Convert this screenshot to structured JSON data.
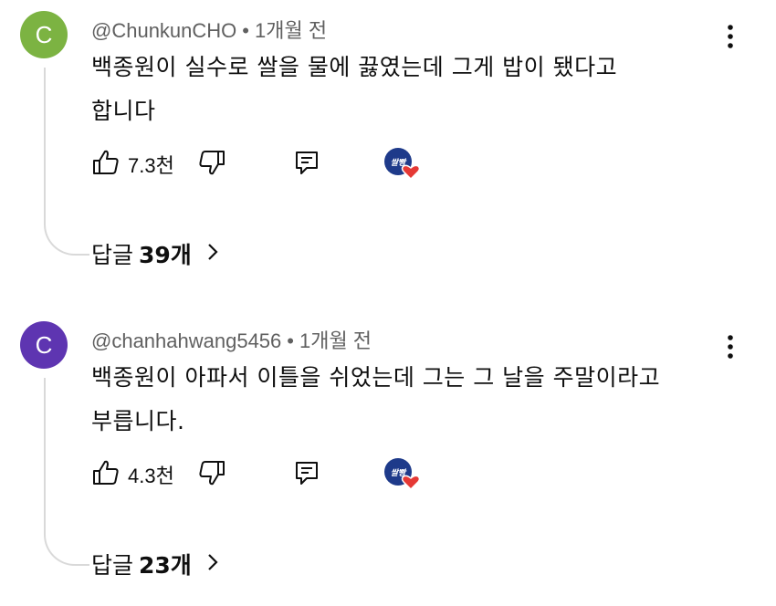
{
  "comments": [
    {
      "avatar_letter": "C",
      "avatar_color": "#7cb342",
      "handle": "@ChunkunCHO",
      "separator": "•",
      "time": "1개월 전",
      "text": "백종원이 실수로 쌀을 물에 끓였는데 그게 밥이 됐다고\n합니다",
      "likes": "7.3천",
      "replies_label": "답글",
      "replies_count": "39개"
    },
    {
      "avatar_letter": "C",
      "avatar_color": "#5e35b1",
      "handle": "@chanhahwang5456",
      "separator": "•",
      "time": "1개월 전",
      "text": "백종원이 아파서 이틀을 쉬었는데 그는 그 날을 주말이라고\n부릅니다.",
      "likes": "4.3천",
      "replies_label": "답글",
      "replies_count": "23개"
    }
  ],
  "icons": {
    "like": "thumbs-up-icon",
    "dislike": "thumbs-down-icon",
    "reply": "reply-icon",
    "more": "more-vert-icon",
    "creator_heart": "creator-heart-icon",
    "chevron": "chevron-right-icon"
  },
  "colors": {
    "heart": "#e53935",
    "badge": "#1e3a8a"
  }
}
